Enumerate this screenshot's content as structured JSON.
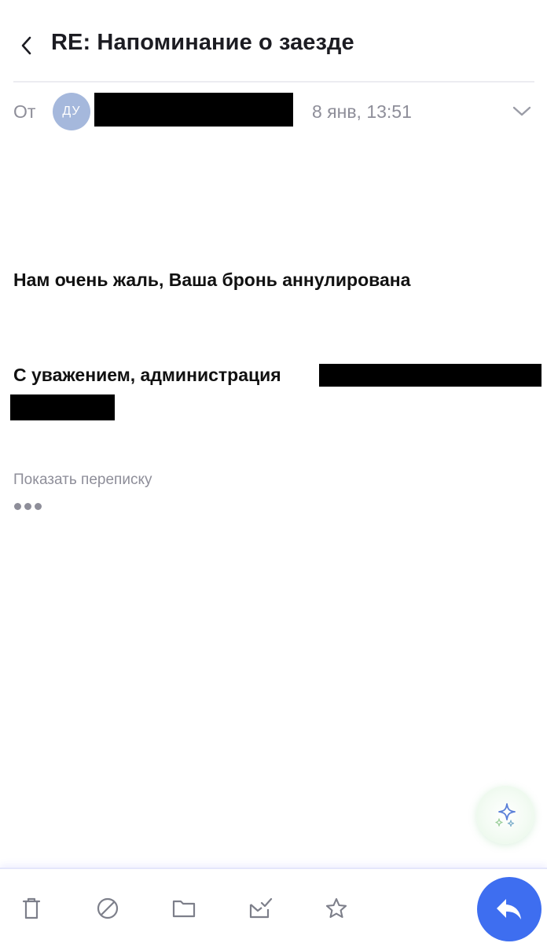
{
  "header": {
    "subject": "RE: Напоминание о заезде"
  },
  "message": {
    "from_label": "От",
    "avatar_initials": "ДУ",
    "date": "8 янв, 13:51",
    "body_line1": "Нам очень жаль, Ваша бронь аннулирована",
    "body_line2": "С уважением, администрация",
    "show_thread_label": "Показать переписку"
  },
  "icons": {
    "back": "chevron-left-icon",
    "expand": "chevron-down-icon",
    "ai": "sparkle-icon",
    "delete": "trash-icon",
    "spam": "block-icon",
    "move": "folder-icon",
    "mark_read": "envelope-check-icon",
    "flag": "star-icon",
    "reply": "reply-arrow-icon"
  },
  "colors": {
    "accent": "#3e6ef0",
    "avatar": "#a5b8dc",
    "muted_text": "#8e8e99",
    "icon_gray": "#7d7f8a"
  }
}
